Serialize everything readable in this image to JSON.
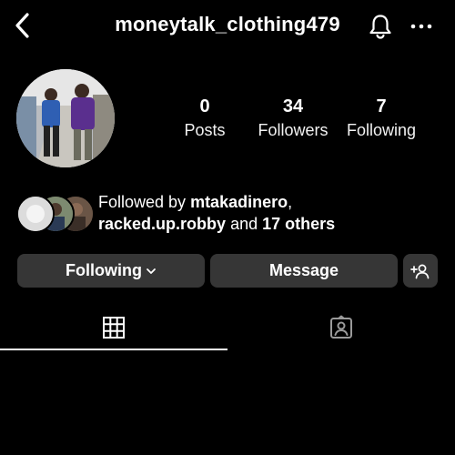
{
  "header": {
    "username": "moneytalk_clothing479",
    "back_icon": "chevron-left-icon",
    "bell_icon": "bell-icon",
    "more_icon": "more-horizontal-icon"
  },
  "stats": {
    "posts": {
      "value": "0",
      "label": "Posts"
    },
    "followers": {
      "value": "34",
      "label": "Followers"
    },
    "following": {
      "value": "7",
      "label": "Following"
    }
  },
  "followed_by": {
    "prefix": "Followed by",
    "user1": "mtakadinero",
    "comma": ",",
    "user2": "racked.up.robby",
    "conjunction": "and",
    "others": "17 others"
  },
  "buttons": {
    "following_label": "Following",
    "message_label": "Message",
    "add_person_icon": "add-person-icon"
  },
  "tabs": {
    "grid_icon": "grid-icon",
    "tagged_icon": "tagged-icon"
  },
  "colors": {
    "background": "#000000",
    "button_bg": "#363636",
    "text": "#ffffff"
  }
}
